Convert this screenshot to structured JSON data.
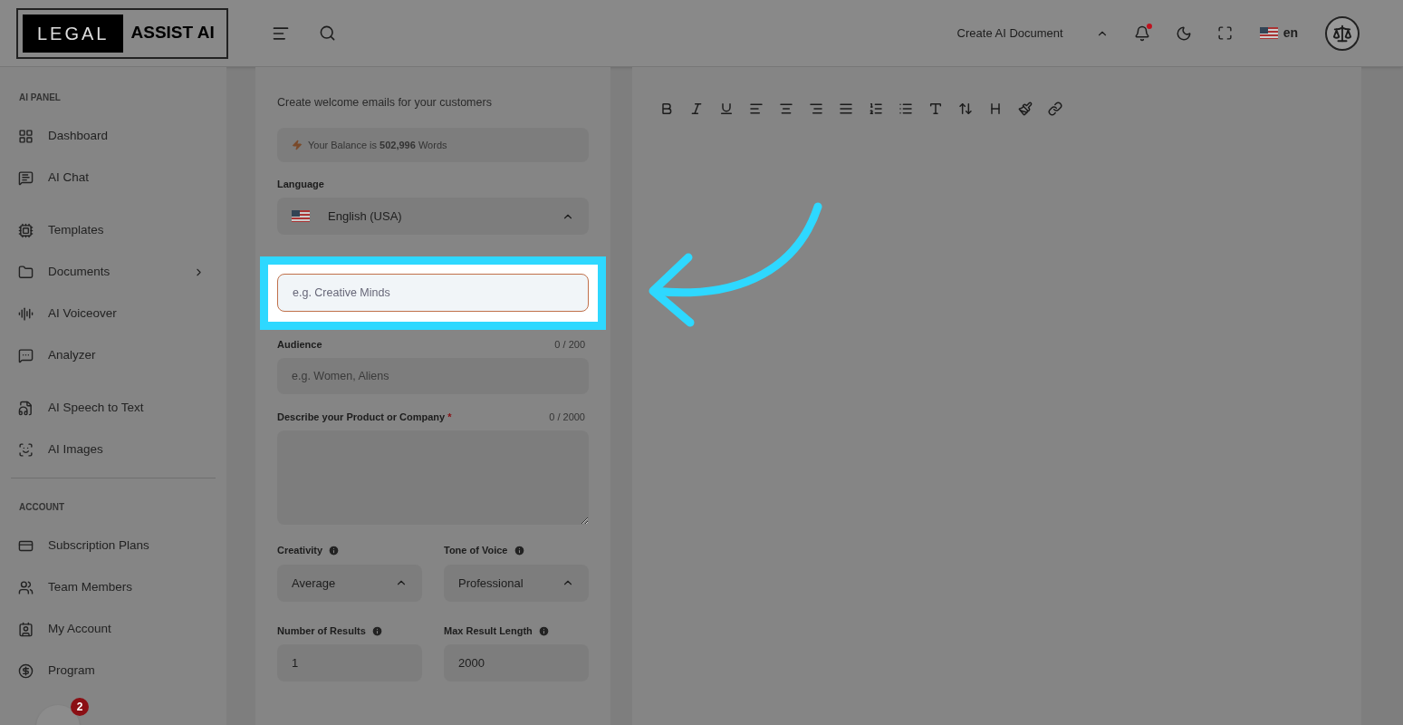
{
  "header": {
    "logo": {
      "dark_part": "LEGAL",
      "light_part": "ASSIST AI"
    },
    "create_menu": "Create AI Document",
    "notifications": {
      "unread": true
    },
    "language": "en"
  },
  "sidebar": {
    "sections": [
      {
        "title": "AI PANEL",
        "items": [
          {
            "label": "Dashboard",
            "expandable": false
          },
          {
            "label": "AI Chat",
            "expandable": false
          },
          {
            "label": "Templates",
            "expandable": false
          },
          {
            "label": "Documents",
            "expandable": true
          },
          {
            "label": "AI Voiceover",
            "expandable": false
          },
          {
            "label": "Analyzer",
            "expandable": false
          },
          {
            "label": "AI Speech to Text",
            "expandable": false
          },
          {
            "label": "AI Images",
            "expandable": false
          }
        ]
      },
      {
        "title": "ACCOUNT",
        "items": [
          {
            "label": "Subscription Plans",
            "expandable": false
          },
          {
            "label": "Team Members",
            "expandable": false
          },
          {
            "label": "My Account",
            "expandable": false
          },
          {
            "label": "Program",
            "expandable": false
          }
        ]
      }
    ]
  },
  "chat_widget": {
    "badge": "2"
  },
  "form": {
    "description": "Create welcome emails for your customers",
    "balance": "Your Balance is **502,996** Words",
    "language": {
      "label": "Language",
      "value": "English (USA)"
    },
    "company_field": {
      "placeholder": "e.g. Creative Minds",
      "focused": true
    },
    "audience": {
      "label": "Audience",
      "counter": "0 / 200",
      "placeholder": "e.g. Women, Aliens"
    },
    "describe": {
      "label": "Describe your Product or Company",
      "required_mark": "*",
      "counter": "0 / 2000"
    },
    "selects": [
      {
        "label": "Creativity",
        "value": "Average"
      },
      {
        "label": "Tone of Voice",
        "value": "Professional"
      }
    ],
    "inputs": [
      {
        "label": "Number of Results",
        "value": "1"
      },
      {
        "label": "Max Result Length",
        "value": "2000"
      }
    ]
  }
}
